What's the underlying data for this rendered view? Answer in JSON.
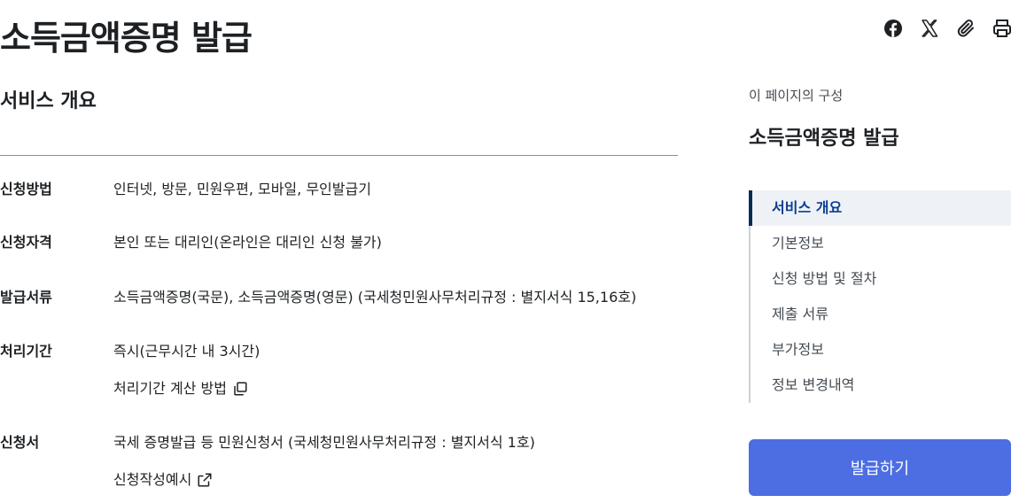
{
  "page": {
    "title": "소득금액증명 발급"
  },
  "share": [
    {
      "name": "facebook-icon"
    },
    {
      "name": "x-icon"
    },
    {
      "name": "attachment-icon"
    },
    {
      "name": "print-icon"
    }
  ],
  "main": {
    "section_title": "서비스 개요",
    "rows": [
      {
        "key": "신청방법",
        "value": "인터넷, 방문, 민원우편, 모바일, 무인발급기"
      },
      {
        "key": "신청자격",
        "value": "본인 또는 대리인(온라인은 대리인 신청 불가)"
      },
      {
        "key": "발급서류",
        "value": "소득금액증명(국문), 소득금액증명(영문) (국세청민원사무처리규정 : 별지서식 15,16호)"
      },
      {
        "key": "처리기간",
        "value": "즉시(근무시간 내 3시간)",
        "link": {
          "label": "처리기간 계산 방법",
          "icon": "copy-icon"
        }
      },
      {
        "key": "신청서",
        "value": "국세 증명발급 등 민원신청서 (국세청민원사무처리규정 : 별지서식 1호)",
        "link": {
          "label": "신청작성예시",
          "icon": "external-link-icon"
        }
      }
    ]
  },
  "toc": {
    "caption": "이 페이지의 구성",
    "title": "소득금액증명 발급",
    "items": [
      {
        "label": "서비스 개요",
        "active": true
      },
      {
        "label": "기본정보"
      },
      {
        "label": "신청 방법 및 절차"
      },
      {
        "label": "제출 서류"
      },
      {
        "label": "부가정보"
      },
      {
        "label": "정보 변경내역"
      }
    ]
  },
  "action": {
    "issue_label": "발급하기"
  },
  "colors": {
    "primary_button": "#4c6ee2",
    "toc_active_bg": "#eef2f7",
    "toc_active_bar": "#052b57"
  }
}
